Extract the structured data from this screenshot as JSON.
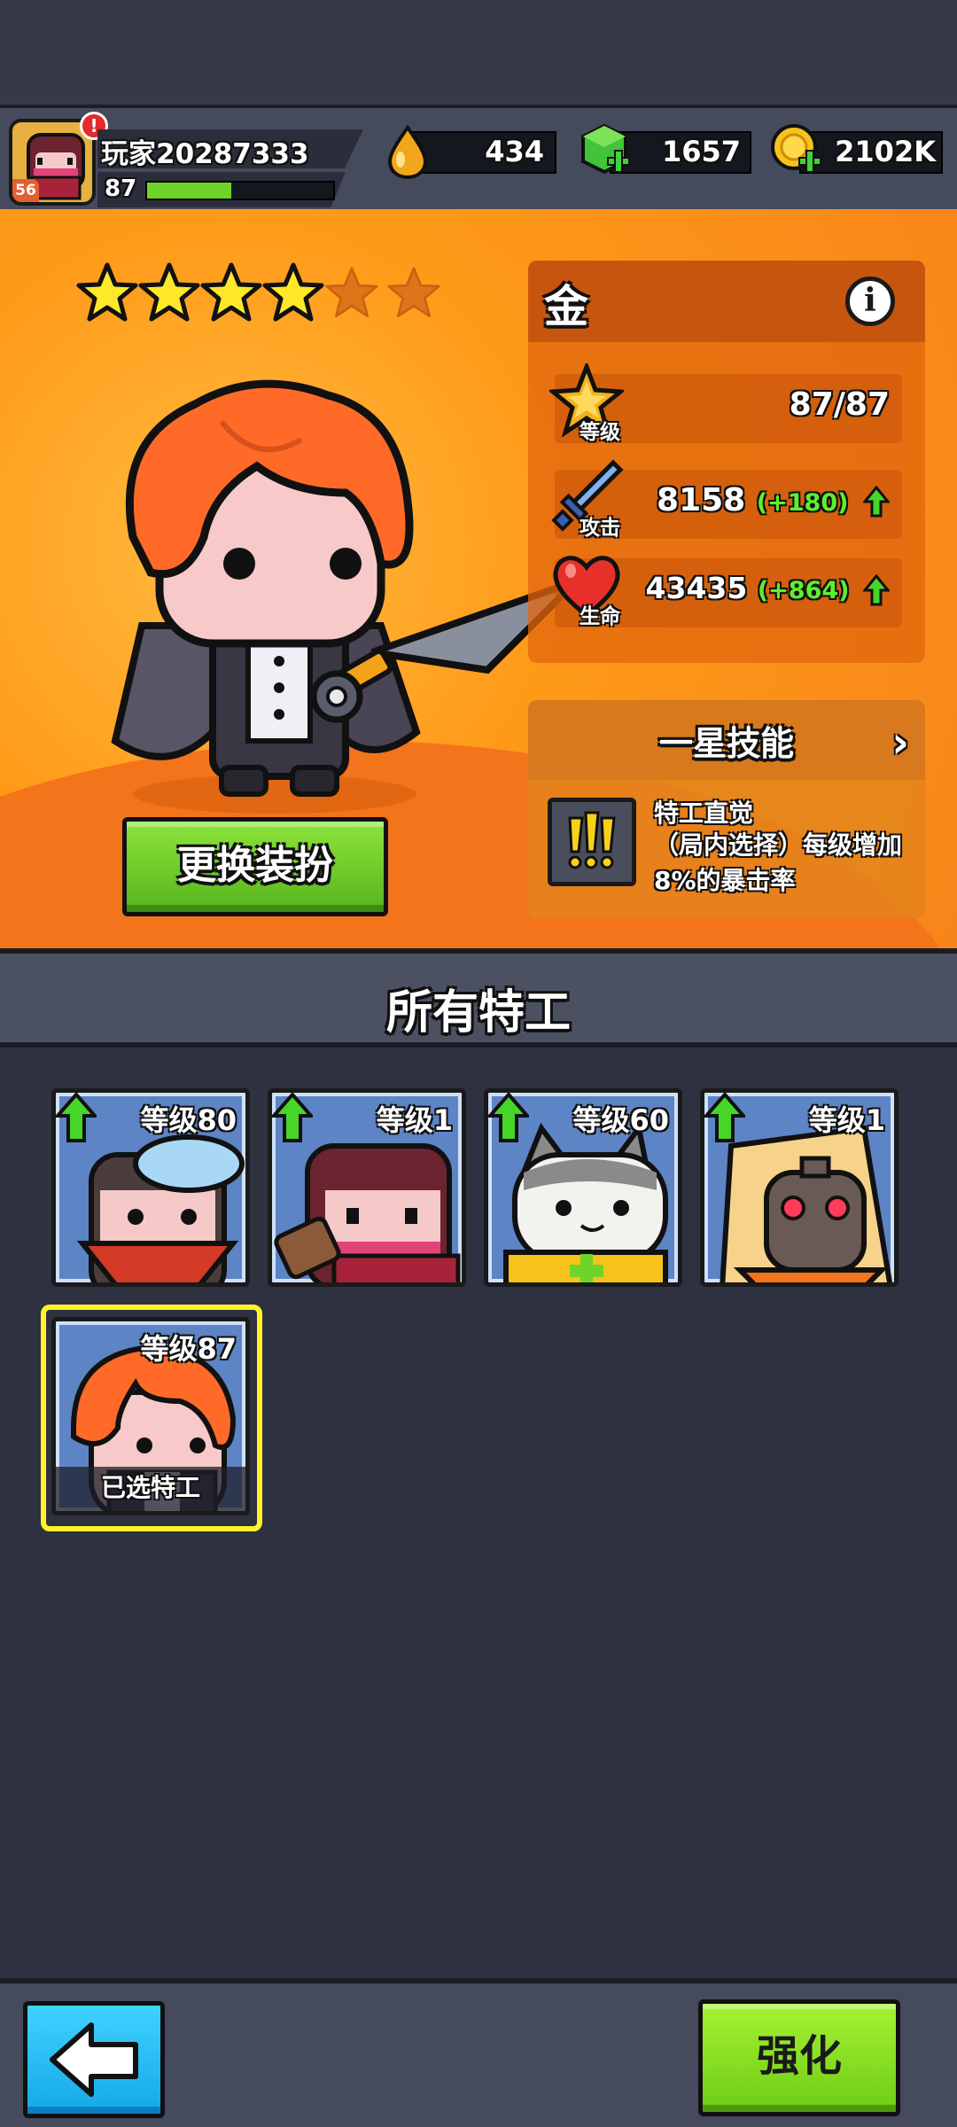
{
  "player": {
    "name": "玩家20287333",
    "avatar_level": "56",
    "level": "87",
    "xp_fraction": 0.45,
    "alert": "!"
  },
  "currencies": [
    {
      "name": "energy",
      "icon": "drop-icon",
      "value": "434"
    },
    {
      "name": "gems",
      "icon": "green-gem-icon",
      "value": "1657"
    },
    {
      "name": "coins",
      "icon": "gold-coin-icon",
      "value": "2102K"
    }
  ],
  "hero": {
    "stars_filled": 4,
    "stars_total": 6,
    "costume_button": "更换装扮",
    "rarity": "金",
    "info_icon": "i",
    "stats": {
      "level": {
        "label": "等级",
        "value": "87/87"
      },
      "attack": {
        "label": "攻击",
        "value": "8158",
        "bonus": "(+180)"
      },
      "hp": {
        "label": "生命",
        "value": "43435",
        "bonus": "(+864)"
      }
    },
    "skill": {
      "title": "一星技能",
      "chevron": "›",
      "name": "特工直觉",
      "description": "（局内选择）每级增加8%的暴击率"
    }
  },
  "agents": {
    "title": "所有特工",
    "items": [
      {
        "level": "等级80",
        "upgradable": true
      },
      {
        "level": "等级1",
        "upgradable": true
      },
      {
        "level": "等级60",
        "upgradable": true
      },
      {
        "level": "等级1",
        "upgradable": true
      },
      {
        "level": "等级87",
        "upgradable": false,
        "selected_label": "已选特工"
      }
    ]
  },
  "bottom": {
    "upgrade_label": "强化"
  },
  "colors": {
    "accent_green": "#6fd42a",
    "hero_bg": "#ff9a18",
    "selected": "#fff22a",
    "back_blue": "#14a8e8"
  }
}
